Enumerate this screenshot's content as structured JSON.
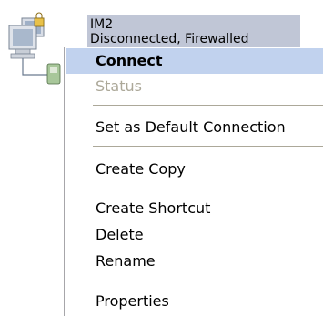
{
  "connection": {
    "name": "IM2",
    "status": "Disconnected, Firewalled",
    "icon": "network-connection-icon"
  },
  "context_menu": {
    "items": [
      {
        "label": "Connect",
        "state": "highlighted-default"
      },
      {
        "label": "Status",
        "state": "disabled"
      },
      {
        "label": "Set as Default Connection",
        "state": "normal"
      },
      {
        "label": "Create Copy",
        "state": "normal"
      },
      {
        "label": "Create Shortcut",
        "state": "normal"
      },
      {
        "label": "Delete",
        "state": "normal"
      },
      {
        "label": "Rename",
        "state": "normal"
      },
      {
        "label": "Properties",
        "state": "normal"
      }
    ]
  },
  "colors": {
    "highlight": "#c1d2ee",
    "label_selection": "#c0c6d6",
    "disabled_text": "#aca899",
    "separator": "#aca899"
  }
}
